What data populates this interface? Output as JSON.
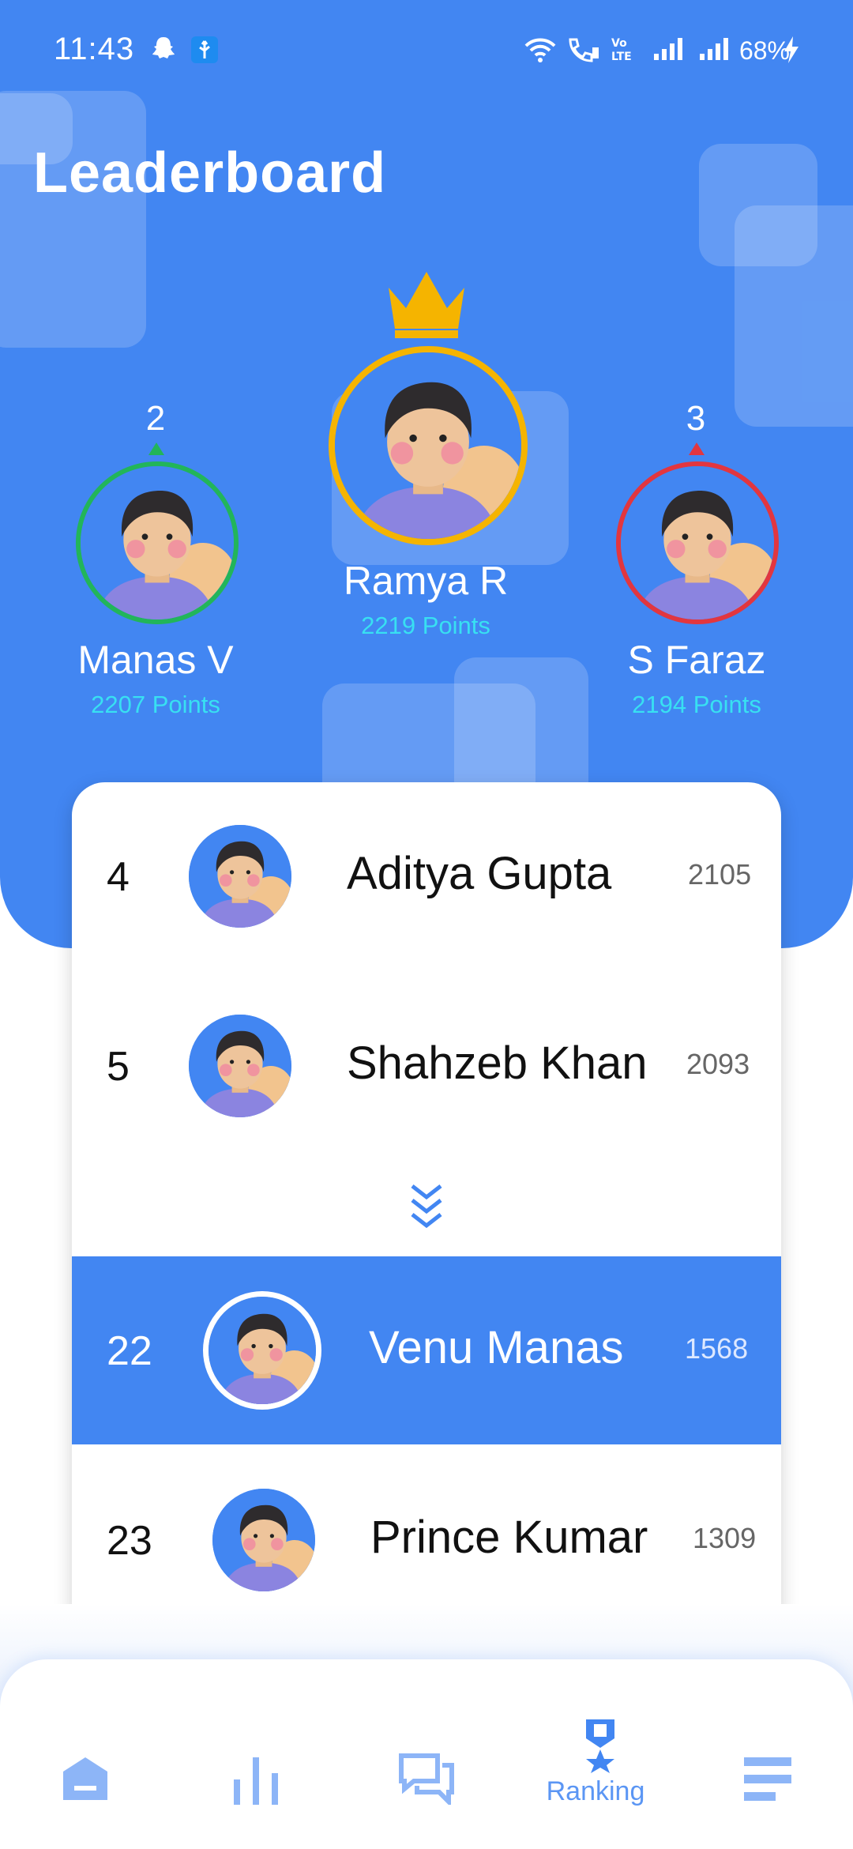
{
  "status": {
    "time": "11:43",
    "battery": "68%"
  },
  "header": {
    "title": "Leaderboard"
  },
  "podium": {
    "first": {
      "name": "Ramya R",
      "points": "2219 Points",
      "ring_color": "#F5B400"
    },
    "second": {
      "rank": "2",
      "name": "Manas V",
      "points": "2207 Points",
      "ring_color": "#22B55A"
    },
    "third": {
      "rank": "3",
      "name": "S Faraz",
      "points": "2194 Points",
      "ring_color": "#E2363F"
    }
  },
  "list": [
    {
      "rank": "4",
      "name": "Aditya Gupta",
      "score": "2105",
      "current_user": false
    },
    {
      "rank": "5",
      "name": "Shahzeb Khan",
      "score": "2093",
      "current_user": false
    },
    {
      "rank": "22",
      "name": "Venu Manas",
      "score": "1568",
      "current_user": true
    },
    {
      "rank": "23",
      "name": "Prince Kumar",
      "score": "1309",
      "current_user": false
    }
  ],
  "nav": [
    {
      "icon": "home-icon",
      "label": ""
    },
    {
      "icon": "stats-icon",
      "label": ""
    },
    {
      "icon": "chat-icon",
      "label": ""
    },
    {
      "icon": "ranking-medal-icon",
      "label": "Ranking",
      "active": true
    },
    {
      "icon": "menu-icon",
      "label": ""
    }
  ],
  "colors": {
    "primary": "#4286F2",
    "points": "#38E0F2",
    "nav_icon": "#8DB5F7"
  }
}
